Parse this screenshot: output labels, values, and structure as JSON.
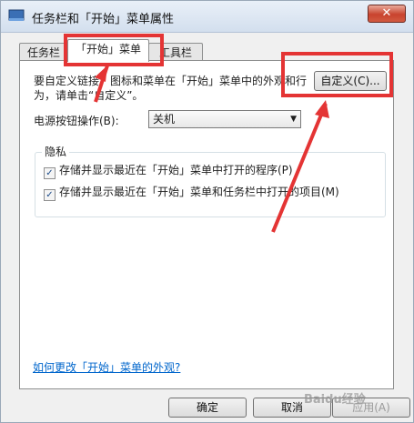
{
  "window": {
    "title": "任务栏和「开始」菜单属性",
    "close_glyph": "✕"
  },
  "tabs": [
    {
      "label": "任务栏"
    },
    {
      "label": "「开始」菜单"
    },
    {
      "label": "工具栏"
    }
  ],
  "start_menu": {
    "description": "要自定义链接、图标和菜单在「开始」菜单中的外观和行为，请单击“自定义”。",
    "customize_button": "自定义(C)...",
    "power_label": "电源按钮操作(B):",
    "power_value": "关机",
    "privacy": {
      "legend": "隐私",
      "checkboxes": [
        {
          "label": "存储并显示最近在「开始」菜单中打开的程序(P)",
          "checked": true
        },
        {
          "label": "存储并显示最近在「开始」菜单和任务栏中打开的项目(M)",
          "checked": true
        }
      ]
    },
    "help_link": "如何更改「开始」菜单的外观?"
  },
  "footer": {
    "ok": "确定",
    "cancel": "取消",
    "apply": "应用(A)"
  },
  "watermark": "Baidu经验",
  "colors": {
    "annotation_red": "#e43434",
    "link_blue": "#0066cc"
  }
}
